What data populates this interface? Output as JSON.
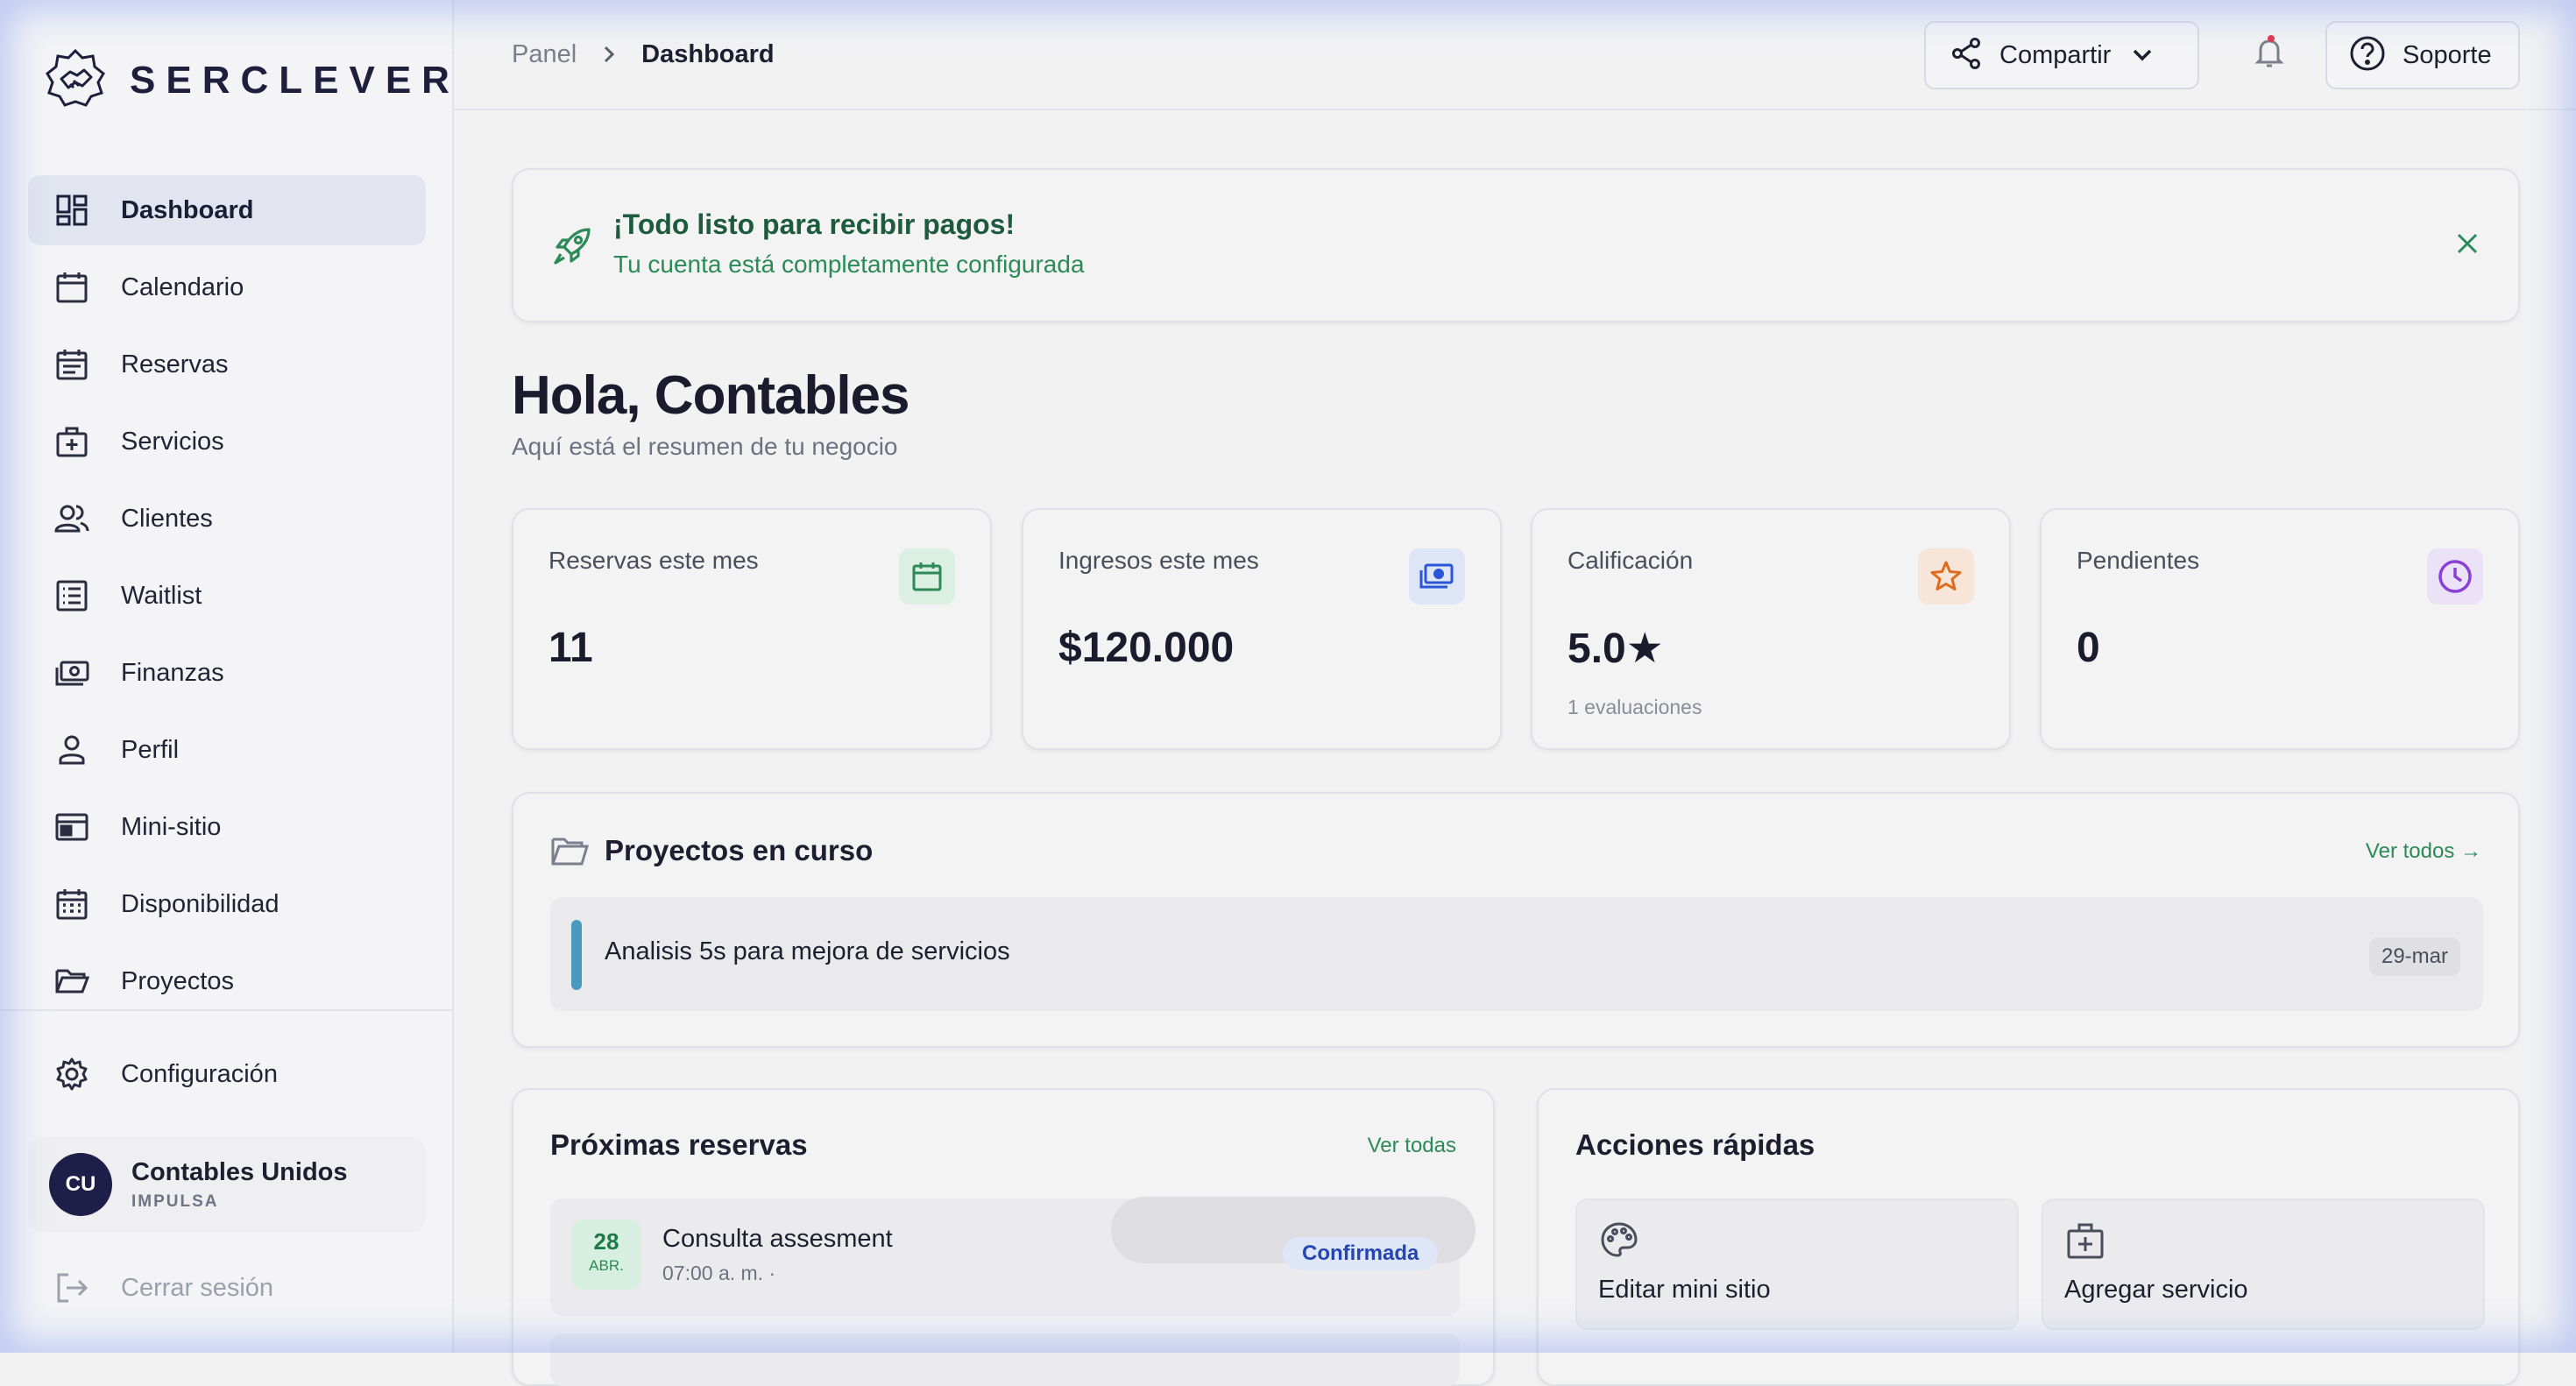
{
  "brand": {
    "name": "SERCLEVER"
  },
  "sidebar": {
    "items": [
      {
        "label": "Dashboard",
        "icon": "dashboard-icon",
        "active": true
      },
      {
        "label": "Calendario",
        "icon": "calendar-icon"
      },
      {
        "label": "Reservas",
        "icon": "reservations-icon"
      },
      {
        "label": "Servicios",
        "icon": "medkit-icon"
      },
      {
        "label": "Clientes",
        "icon": "users-icon"
      },
      {
        "label": "Waitlist",
        "icon": "list-icon"
      },
      {
        "label": "Finanzas",
        "icon": "money-icon"
      },
      {
        "label": "Perfil",
        "icon": "person-icon"
      },
      {
        "label": "Mini-sitio",
        "icon": "website-icon"
      },
      {
        "label": "Disponibilidad",
        "icon": "availability-icon"
      },
      {
        "label": "Proyectos",
        "icon": "folder-icon"
      }
    ],
    "config_label": "Configuración",
    "user": {
      "initials": "CU",
      "name": "Contables Unidos",
      "plan": "IMPULSA"
    },
    "logout_label": "Cerrar sesión"
  },
  "topbar": {
    "breadcrumb": [
      "Panel",
      "Dashboard"
    ],
    "share_label": "Compartir",
    "support_label": "Soporte"
  },
  "banner": {
    "title": "¡Todo listo para recibir pagos!",
    "subtitle": "Tu cuenta está completamente configurada"
  },
  "greeting": {
    "title": "Hola, Contables",
    "subtitle": "Aquí está el resumen de tu negocio"
  },
  "stats": [
    {
      "label": "Reservas este mes",
      "value": "11",
      "icon": "calendar-icon",
      "color": "#2b8a57"
    },
    {
      "label": "Ingresos este mes",
      "value": "$120.000",
      "icon": "money-icon",
      "color": "#2a55d6"
    },
    {
      "label": "Calificación",
      "value": "5.0★",
      "sub": "1 evaluaciones",
      "icon": "star-icon",
      "color": "#e06b1f"
    },
    {
      "label": "Pendientes",
      "value": "0",
      "icon": "clock-icon",
      "color": "#8a3fd6"
    }
  ],
  "projects": {
    "title": "Proyectos en curso",
    "view_all": "Ver todos →",
    "items": [
      {
        "name": "Analisis 5s para mejora de servicios",
        "date": "29-mar"
      }
    ]
  },
  "reservations": {
    "title": "Próximas reservas",
    "view_all": "Ver todas",
    "items": [
      {
        "day": "28",
        "month": "ABR.",
        "name": "Consulta assesment",
        "time": "07:00 a. m. ·",
        "status": "Confirmada"
      }
    ]
  },
  "quick_actions": {
    "title": "Acciones rápidas",
    "items": [
      {
        "label": "Editar mini sitio",
        "icon": "palette-icon"
      },
      {
        "label": "Agregar servicio",
        "icon": "medkit-icon"
      }
    ]
  }
}
